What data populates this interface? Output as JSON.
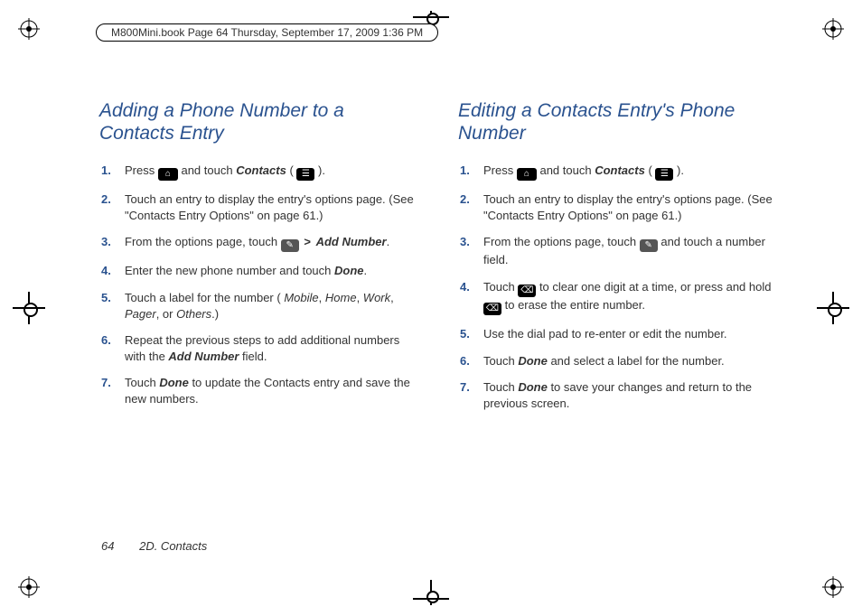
{
  "page_header": "M800Mini.book  Page 64  Thursday, September 17, 2009  1:36 PM",
  "footer": {
    "page_number": "64",
    "section": "2D. Contacts"
  },
  "left": {
    "title": "Adding a Phone Number to a Contacts Entry",
    "steps": {
      "s1a": "Press ",
      "s1b": " and touch ",
      "s1c": "Contacts",
      "s1d": " ( ",
      "s1e": " ).",
      "s2": "Touch an entry to display the entry's options page. (See \"Contacts Entry Options\" on page 61.)",
      "s3a": "From the options page, touch ",
      "s3b": "Add Number",
      "s3c": ".",
      "s4a": "Enter the new phone number and touch ",
      "s4b": "Done",
      "s4c": ".",
      "s5a": "Touch a label for the number (",
      "s5b": "Mobile",
      "s5c": ", ",
      "s5d": "Home",
      "s5e": ", ",
      "s5f": "Work",
      "s5g": ", ",
      "s5h": "Pager",
      "s5i": ", or ",
      "s5j": "Others",
      "s5k": ".)",
      "s6a": "Repeat the previous steps to add additional numbers with the ",
      "s6b": "Add Number",
      "s6c": " field.",
      "s7a": "Touch ",
      "s7b": "Done",
      "s7c": " to update the Contacts entry and save the new numbers."
    }
  },
  "right": {
    "title": "Editing a Contacts Entry's Phone Number",
    "steps": {
      "s1a": "Press ",
      "s1b": " and touch ",
      "s1c": "Contacts",
      "s1d": " ( ",
      "s1e": " ).",
      "s2": "Touch an entry to display the entry's options page. (See \"Contacts Entry Options\" on page 61.)",
      "s3a": "From the options page, touch ",
      "s3b": " and touch a number field.",
      "s4a": "Touch ",
      "s4b": " to clear one digit at a time, or press and hold ",
      "s4c": " to erase the entire number.",
      "s5": "Use the dial pad to re-enter or edit the number.",
      "s6a": "Touch ",
      "s6b": "Done",
      "s6c": " and select a label for the number.",
      "s7a": "Touch ",
      "s7b": "Done",
      "s7c": " to save your changes and return to the previous screen."
    }
  },
  "icons": {
    "home_key": "⌂",
    "contacts": "☰",
    "edit_pencil": "✎",
    "backspace": "⌫",
    "gt": ">"
  }
}
